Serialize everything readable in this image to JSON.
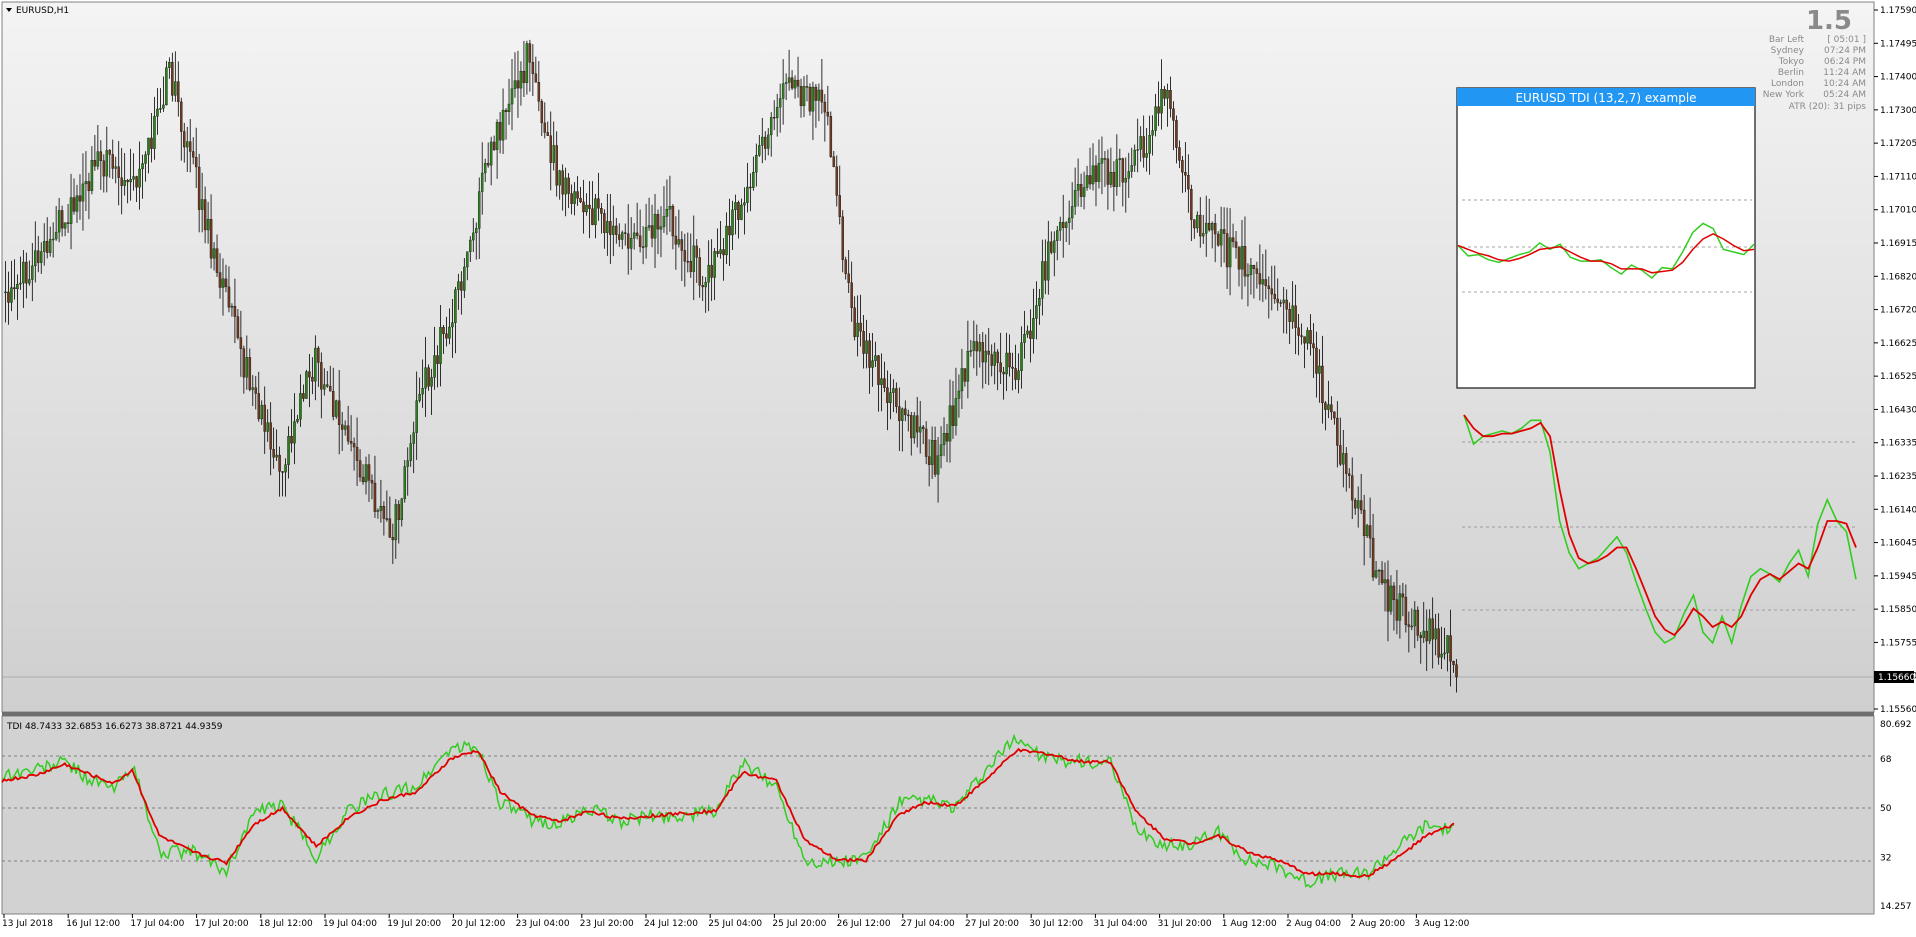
{
  "main": {
    "symbol_label": "EURUSD,H1",
    "price_ticks": [
      "1.17590",
      "1.17495",
      "1.17400",
      "1.17300",
      "1.17205",
      "1.17110",
      "1.17010",
      "1.16915",
      "1.16820",
      "1.16720",
      "1.16625",
      "1.16525",
      "1.16430",
      "1.16335",
      "1.16235",
      "1.16140",
      "1.16045",
      "1.15945",
      "1.15850",
      "1.15755",
      "1.15660",
      "1.15560"
    ],
    "current_price": "1.15660",
    "big_number": "1.5",
    "info_panel": [
      {
        "label": "Bar Left",
        "value": "[ 05:01 ]"
      },
      {
        "label": "Sydney",
        "value": "07:24 PM"
      },
      {
        "label": "Tokyo",
        "value": "06:24 PM"
      },
      {
        "label": "Berlin",
        "value": "11:24 AM"
      },
      {
        "label": "London",
        "value": "10:24 AM"
      },
      {
        "label": "New York",
        "value": "05:24 AM"
      }
    ],
    "atr_text": "ATR (20): 31 pips",
    "example_box_title": "EURUSD TDI (13,2,7) example"
  },
  "indicator": {
    "label": "TDI 48.7433 32.6853 16.6273 38.8721 44.9359",
    "ticks": [
      "80.692",
      "68",
      "50",
      "32",
      "14.257"
    ]
  },
  "time_axis": [
    "13 Jul 2018",
    "16 Jul 12:00",
    "17 Jul 04:00",
    "17 Jul 20:00",
    "18 Jul 12:00",
    "19 Jul 04:00",
    "19 Jul 20:00",
    "20 Jul 12:00",
    "23 Jul 04:00",
    "23 Jul 20:00",
    "24 Jul 12:00",
    "25 Jul 04:00",
    "25 Jul 20:00",
    "26 Jul 12:00",
    "27 Jul 04:00",
    "27 Jul 20:00",
    "30 Jul 12:00",
    "31 Jul 04:00",
    "31 Jul 20:00",
    "1 Aug 12:00",
    "2 Aug 04:00",
    "2 Aug 20:00",
    "3 Aug 12:00"
  ],
  "colors": {
    "bull_candle": "#2e7d1e",
    "bear_candle": "#6b3a1f",
    "tdi_green": "#33cc22",
    "tdi_red": "#e00000",
    "title_bar": "#2196f3"
  },
  "chart_data": [
    {
      "type": "candlestick",
      "title": "EURUSD,H1",
      "ylim": [
        1.1556,
        1.1759
      ],
      "key_points": [
        {
          "i": 0,
          "p": 1.1678
        },
        {
          "i": 15,
          "p": 1.1692
        },
        {
          "i": 32,
          "p": 1.1715
        },
        {
          "i": 45,
          "p": 1.171
        },
        {
          "i": 55,
          "p": 1.1742
        },
        {
          "i": 65,
          "p": 1.1705
        },
        {
          "i": 78,
          "p": 1.1662
        },
        {
          "i": 92,
          "p": 1.1625
        },
        {
          "i": 104,
          "p": 1.1658
        },
        {
          "i": 118,
          "p": 1.1628
        },
        {
          "i": 130,
          "p": 1.1607
        },
        {
          "i": 140,
          "p": 1.165
        },
        {
          "i": 150,
          "p": 1.167
        },
        {
          "i": 163,
          "p": 1.1718
        },
        {
          "i": 175,
          "p": 1.1745
        },
        {
          "i": 185,
          "p": 1.1712
        },
        {
          "i": 197,
          "p": 1.17
        },
        {
          "i": 210,
          "p": 1.169
        },
        {
          "i": 222,
          "p": 1.17
        },
        {
          "i": 235,
          "p": 1.168
        },
        {
          "i": 248,
          "p": 1.1705
        },
        {
          "i": 262,
          "p": 1.174
        },
        {
          "i": 275,
          "p": 1.173
        },
        {
          "i": 285,
          "p": 1.1665
        },
        {
          "i": 298,
          "p": 1.1645
        },
        {
          "i": 312,
          "p": 1.1628
        },
        {
          "i": 325,
          "p": 1.166
        },
        {
          "i": 340,
          "p": 1.1655
        },
        {
          "i": 352,
          "p": 1.1695
        },
        {
          "i": 365,
          "p": 1.1712
        },
        {
          "i": 378,
          "p": 1.1712
        },
        {
          "i": 390,
          "p": 1.1735
        },
        {
          "i": 400,
          "p": 1.1695
        },
        {
          "i": 412,
          "p": 1.1688
        },
        {
          "i": 425,
          "p": 1.1678
        },
        {
          "i": 438,
          "p": 1.1662
        },
        {
          "i": 450,
          "p": 1.1625
        },
        {
          "i": 462,
          "p": 1.159
        },
        {
          "i": 475,
          "p": 1.158
        },
        {
          "i": 487,
          "p": 1.157
        }
      ]
    },
    {
      "type": "line",
      "title": "TDI",
      "ylim": [
        14.257,
        80.692
      ],
      "levels": [
        68,
        50,
        32
      ],
      "series": [
        {
          "values_key_points": [
            [
              0,
              62
            ],
            [
              15,
              64
            ],
            [
              28,
              67
            ],
            [
              40,
              60
            ],
            [
              50,
              57
            ],
            [
              58,
              66
            ],
            [
              70,
              34
            ],
            [
              85,
              34
            ],
            [
              100,
              27
            ],
            [
              112,
              48
            ],
            [
              125,
              51
            ],
            [
              140,
              32
            ],
            [
              155,
              50
            ],
            [
              170,
              55
            ],
            [
              185,
              58
            ],
            [
              200,
              72
            ],
            [
              212,
              72
            ],
            [
              222,
              52
            ],
            [
              235,
              46
            ],
            [
              248,
              44
            ],
            [
              262,
              50
            ],
            [
              275,
              45
            ],
            [
              288,
              47
            ],
            [
              302,
              47
            ],
            [
              318,
              49
            ],
            [
              330,
              66
            ],
            [
              345,
              58
            ],
            [
              358,
              31
            ],
            [
              372,
              30
            ],
            [
              385,
              32
            ],
            [
              400,
              52
            ],
            [
              412,
              53
            ],
            [
              425,
              50
            ],
            [
              438,
              63
            ],
            [
              452,
              76
            ],
            [
              465,
              68
            ],
            [
              480,
              67
            ],
            [
              494,
              66
            ],
            [
              505,
              43
            ],
            [
              518,
              36
            ],
            [
              530,
              37
            ],
            [
              542,
              41
            ],
            [
              555,
              31
            ],
            [
              568,
              29
            ],
            [
              582,
              23
            ],
            [
              595,
              26
            ],
            [
              608,
              26
            ],
            [
              622,
              36
            ],
            [
              635,
              44
            ],
            [
              647,
              42
            ]
          ]
        },
        {
          "values_key_points": [
            [
              0,
              60
            ],
            [
              15,
              62
            ],
            [
              28,
              66
            ],
            [
              40,
              62
            ],
            [
              50,
              59
            ],
            [
              58,
              64
            ],
            [
              70,
              40
            ],
            [
              85,
              34
            ],
            [
              100,
              30
            ],
            [
              112,
              44
            ],
            [
              125,
              50
            ],
            [
              140,
              36
            ],
            [
              155,
              47
            ],
            [
              170,
              53
            ],
            [
              185,
              56
            ],
            [
              200,
              68
            ],
            [
              212,
              71
            ],
            [
              222,
              56
            ],
            [
              235,
              48
            ],
            [
              248,
              45
            ],
            [
              262,
              49
            ],
            [
              275,
              46
            ],
            [
              288,
              47
            ],
            [
              302,
              48
            ],
            [
              318,
              49
            ],
            [
              330,
              63
            ],
            [
              345,
              60
            ],
            [
              358,
              38
            ],
            [
              372,
              31
            ],
            [
              385,
              31
            ],
            [
              400,
              48
            ],
            [
              412,
              52
            ],
            [
              425,
              51
            ],
            [
              438,
              60
            ],
            [
              452,
              71
            ],
            [
              465,
              70
            ],
            [
              480,
              67
            ],
            [
              494,
              67
            ],
            [
              505,
              49
            ],
            [
              518,
              39
            ],
            [
              530,
              37
            ],
            [
              542,
              40
            ],
            [
              555,
              34
            ],
            [
              568,
              31
            ],
            [
              582,
              26
            ],
            [
              595,
              26
            ],
            [
              608,
              25
            ],
            [
              622,
              32
            ],
            [
              635,
              40
            ],
            [
              647,
              44
            ]
          ]
        }
      ]
    },
    {
      "type": "line",
      "title": "EURUSD TDI (13,2,7) example",
      "series": [
        {
          "values": [
            0.35,
            0.43,
            0.42,
            0.46,
            0.48,
            0.45,
            0.42,
            0.4,
            0.33,
            0.38,
            0.34,
            0.44,
            0.47,
            0.47,
            0.46,
            0.52,
            0.57,
            0.5,
            0.54,
            0.6,
            0.52,
            0.53,
            0.4,
            0.25,
            0.18,
            0.22,
            0.38,
            0.4,
            0.42,
            0.34
          ]
        },
        {
          "values": [
            0.35,
            0.38,
            0.41,
            0.43,
            0.46,
            0.47,
            0.45,
            0.42,
            0.38,
            0.37,
            0.36,
            0.4,
            0.44,
            0.47,
            0.47,
            0.49,
            0.53,
            0.53,
            0.53,
            0.56,
            0.55,
            0.54,
            0.48,
            0.38,
            0.3,
            0.26,
            0.3,
            0.35,
            0.39,
            0.38
          ]
        }
      ]
    },
    {
      "type": "line",
      "title": "",
      "series": [
        {
          "values": [
            0.0,
            0.11,
            0.08,
            0.07,
            0.06,
            0.07,
            0.05,
            0.02,
            0.02,
            0.14,
            0.4,
            0.52,
            0.58,
            0.56,
            0.54,
            0.5,
            0.46,
            0.52,
            0.63,
            0.73,
            0.82,
            0.86,
            0.84,
            0.75,
            0.68,
            0.82,
            0.86,
            0.76,
            0.86,
            0.72,
            0.61,
            0.58,
            0.6,
            0.63,
            0.56,
            0.51,
            0.61,
            0.41,
            0.32,
            0.4,
            0.44,
            0.62
          ]
        },
        {
          "values": [
            0.0,
            0.05,
            0.08,
            0.08,
            0.07,
            0.07,
            0.06,
            0.05,
            0.03,
            0.08,
            0.28,
            0.45,
            0.54,
            0.56,
            0.55,
            0.53,
            0.5,
            0.5,
            0.58,
            0.67,
            0.76,
            0.81,
            0.83,
            0.79,
            0.73,
            0.76,
            0.8,
            0.78,
            0.8,
            0.76,
            0.68,
            0.62,
            0.6,
            0.62,
            0.59,
            0.56,
            0.58,
            0.5,
            0.4,
            0.4,
            0.41,
            0.5
          ]
        }
      ]
    }
  ]
}
